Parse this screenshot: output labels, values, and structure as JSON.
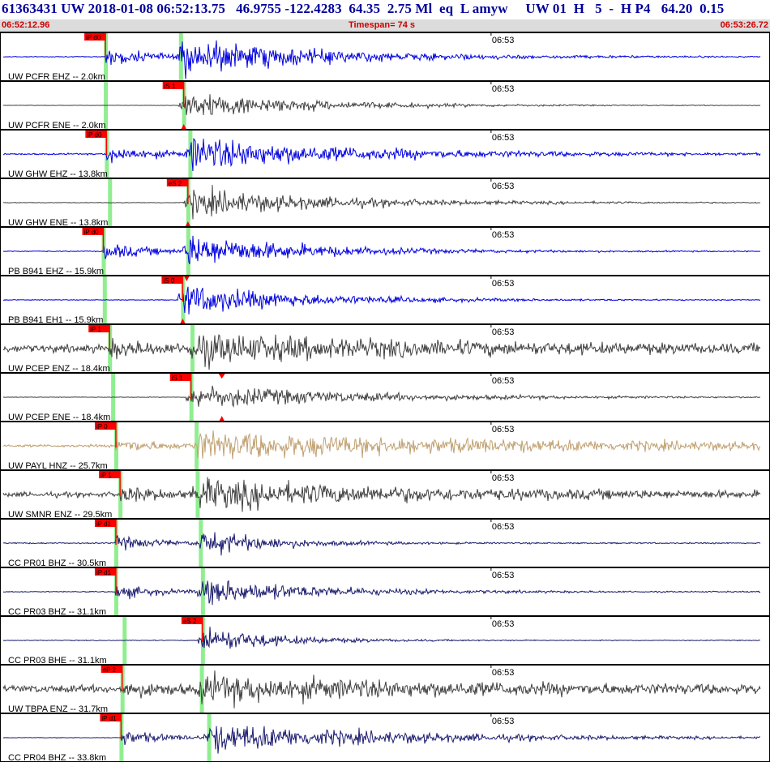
{
  "header": {
    "title": "61363431 UW 2018-01-08 06:52:13.75   46.9755 -122.4283  64.35  2.75 Ml  eq  L amyw     UW 01  H   5  -  H P4   64.20  0.15",
    "start_time": "06:52:12.96",
    "timespan": "Timespan=  74 s",
    "end_time": "06:53:26.72"
  },
  "chart_data": {
    "type": "line",
    "title": "",
    "xlabel": "",
    "ylabel": "",
    "x_range_seconds": [
      0,
      73.76
    ],
    "minute_tick_label": "06:53",
    "minute_tick_offset_s": 47.04,
    "colors": {
      "blue": "#0000e0",
      "gray": "#404040",
      "tan": "#c0a070",
      "navy": "#1c1c70",
      "pick": "#ff0000",
      "window": "#90ee90"
    },
    "channels": [
      {
        "label": "UW PCFR EHZ -- 2.0km",
        "color": "blue",
        "pick": "iP d0",
        "pick_s": 10.1,
        "s_s": 17.3,
        "amp": 0.55,
        "noise": 0.012,
        "coda": 6,
        "ptri": false,
        "utri": false,
        "ltri": false
      },
      {
        "label": "UW PCFR ENE -- 2.0km",
        "color": "gray",
        "pick": "iS 1",
        "pick_s": 17.6,
        "s_s": 17.6,
        "amp": 0.45,
        "noise": 0.006,
        "coda": 5,
        "ptri": false,
        "utri": false,
        "ltri": true
      },
      {
        "label": "UW GHW EHZ -- 13.8km",
        "color": "blue",
        "pick": "iP d0",
        "pick_s": 10.2,
        "s_s": 18.2,
        "amp": 0.5,
        "noise": 0.025,
        "coda": 7,
        "ptri": false,
        "utri": false,
        "ltri": false
      },
      {
        "label": "UW GHW ENE -- 13.8km",
        "color": "gray",
        "pick": "eS 2",
        "pick_s": 18.0,
        "s_s": 18.0,
        "amp": 0.45,
        "noise": 0.01,
        "coda": 6,
        "ptri": false,
        "utri": false,
        "ltri": true
      },
      {
        "label": "PB B941 EHZ -- 15.9km",
        "color": "blue",
        "pick": "iP d0",
        "pick_s": 9.9,
        "s_s": 18.0,
        "amp": 0.5,
        "noise": 0.015,
        "coda": 5,
        "ptri": false,
        "utri": false,
        "ltri": false
      },
      {
        "label": "PB B941 EH1 -- 15.9km",
        "color": "blue",
        "pick": "iS 0",
        "pick_s": 17.5,
        "s_s": 17.5,
        "amp": 0.5,
        "noise": 0.012,
        "coda": 5,
        "ptri": true,
        "utri": false,
        "ltri": true
      },
      {
        "label": "UW PCEP ENZ -- 18.4km",
        "color": "gray",
        "pick": "iP 1",
        "pick_s": 10.5,
        "s_s": 18.4,
        "amp": 0.4,
        "noise": 0.12,
        "coda": 10,
        "ptri": false,
        "utri": false,
        "ltri": false
      },
      {
        "label": "UW PCEP ENE -- 18.4km",
        "color": "gray",
        "pick": "iS 1",
        "pick_s": 18.3,
        "s_s": 18.3,
        "amp": 0.38,
        "noise": 0.01,
        "coda": 7,
        "ptri": false,
        "utri": true,
        "ltri": true
      },
      {
        "label": "UW PAYL HNZ -- 25.7km",
        "color": "tan",
        "pick": "iP 0",
        "pick_s": 11.1,
        "s_s": 18.8,
        "amp": 0.42,
        "noise": 0.04,
        "coda": 15,
        "ptri": false,
        "utri": false,
        "ltri": false
      },
      {
        "label": "UW SMNR ENZ -- 29.5km",
        "color": "gray",
        "pick": "iP 1",
        "pick_s": 11.5,
        "s_s": 18.9,
        "amp": 0.4,
        "noise": 0.08,
        "coda": 10,
        "ptri": false,
        "utri": false,
        "ltri": false
      },
      {
        "label": "CC PR01 BHZ -- 30.5km",
        "color": "navy",
        "pick": "iP d1",
        "pick_s": 11.1,
        "s_s": 19.2,
        "amp": 0.4,
        "noise": 0.02,
        "coda": 3,
        "ptri": false,
        "utri": false,
        "ltri": false
      },
      {
        "label": "CC PR03 BHZ -- 31.1km",
        "color": "navy",
        "pick": "iP d1",
        "pick_s": 11.1,
        "s_s": 19.4,
        "amp": 0.4,
        "noise": 0.015,
        "coda": 5,
        "ptri": false,
        "utri": false,
        "ltri": false
      },
      {
        "label": "CC PR03 BHE -- 31.1km",
        "color": "navy",
        "pick": "eS 2",
        "pick_s": 19.4,
        "s_s": 19.4,
        "amp": 0.45,
        "noise": 0.012,
        "coda": 3,
        "ptri": false,
        "utri": false,
        "ltri": false
      },
      {
        "label": "UW TBPA ENZ -- 31.7km",
        "color": "gray",
        "pick": "eP 2",
        "pick_s": 11.7,
        "s_s": 19.3,
        "amp": 0.36,
        "noise": 0.12,
        "coda": 10,
        "ptri": false,
        "utri": false,
        "ltri": false
      },
      {
        "label": "CC PR04 BHZ -- 33.8km",
        "color": "navy",
        "pick": "iP d1",
        "pick_s": 11.6,
        "s_s": 20.0,
        "amp": 0.45,
        "noise": 0.01,
        "coda": 8,
        "ptri": false,
        "utri": false,
        "ltri": false
      }
    ]
  }
}
